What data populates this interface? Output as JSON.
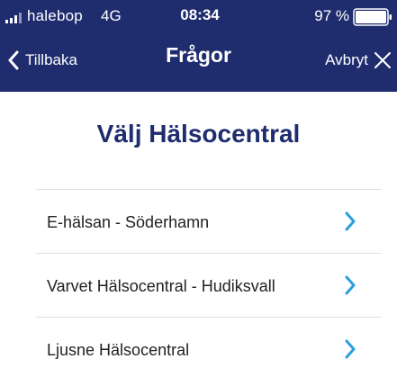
{
  "status_bar": {
    "carrier": "halebop",
    "network": "4G",
    "time": "08:34",
    "battery": "97 %"
  },
  "nav": {
    "back_label": "Tillbaka",
    "title": "Frågor",
    "cancel_label": "Avbryt"
  },
  "page": {
    "title": "Välj Hälsocentral"
  },
  "list": {
    "items": [
      {
        "label": "E-hälsan - Söderhamn"
      },
      {
        "label": "Varvet Hälsocentral - Hudiksvall"
      },
      {
        "label": "Ljusne Hälsocentral"
      }
    ]
  },
  "colors": {
    "header_bg": "#1f2d6e",
    "title_text": "#1f2d6e",
    "chevron": "#2a9ee0"
  },
  "icons": {
    "signal": "signal-icon",
    "battery": "battery-icon",
    "back": "chevron-left-icon",
    "cancel": "close-icon",
    "row": "chevron-right-icon"
  }
}
